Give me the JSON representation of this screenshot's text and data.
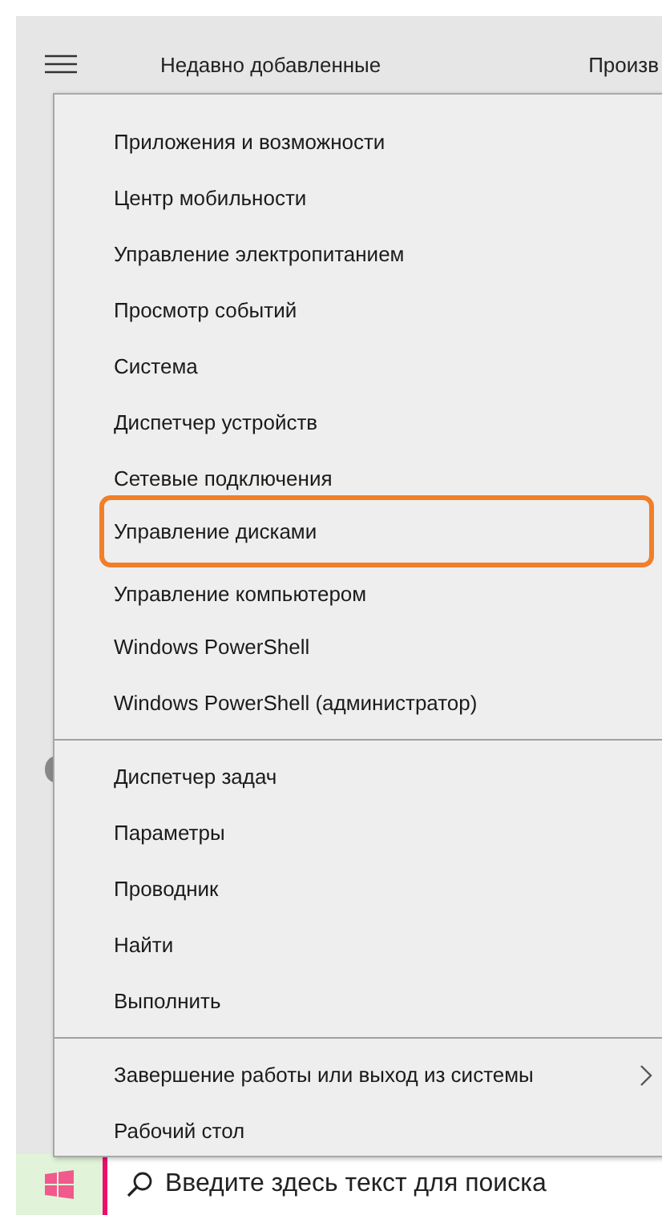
{
  "start_menu": {
    "header": "Недавно добавленные",
    "column_2_heading": "Произв"
  },
  "context_menu": {
    "groups": [
      {
        "items": [
          {
            "label": "Приложения и возможности",
            "highlighted": false,
            "submenu": false
          },
          {
            "label": "Центр мобильности",
            "highlighted": false,
            "submenu": false
          },
          {
            "label": "Управление электропитанием",
            "highlighted": false,
            "submenu": false
          },
          {
            "label": "Просмотр событий",
            "highlighted": false,
            "submenu": false
          },
          {
            "label": "Система",
            "highlighted": false,
            "submenu": false
          },
          {
            "label": "Диспетчер устройств",
            "highlighted": false,
            "submenu": false
          },
          {
            "label": "Сетевые подключения",
            "highlighted": false,
            "submenu": false
          },
          {
            "label": "Управление дисками",
            "highlighted": true,
            "submenu": false
          },
          {
            "label": "Управление компьютером",
            "highlighted": false,
            "submenu": false
          },
          {
            "label": "Windows PowerShell",
            "highlighted": false,
            "submenu": false
          },
          {
            "label": "Windows PowerShell (администратор)",
            "highlighted": false,
            "submenu": false
          }
        ]
      },
      {
        "items": [
          {
            "label": "Диспетчер задач",
            "highlighted": false,
            "submenu": false
          },
          {
            "label": "Параметры",
            "highlighted": false,
            "submenu": false
          },
          {
            "label": "Проводник",
            "highlighted": false,
            "submenu": false
          },
          {
            "label": "Найти",
            "highlighted": false,
            "submenu": false
          },
          {
            "label": "Выполнить",
            "highlighted": false,
            "submenu": false
          }
        ]
      },
      {
        "items": [
          {
            "label": "Завершение работы или выход из системы",
            "highlighted": false,
            "submenu": true
          },
          {
            "label": "Рабочий стол",
            "highlighted": false,
            "submenu": false
          }
        ]
      }
    ]
  },
  "taskbar": {
    "search": {
      "placeholder": "Введите здесь текст для поиска"
    }
  }
}
